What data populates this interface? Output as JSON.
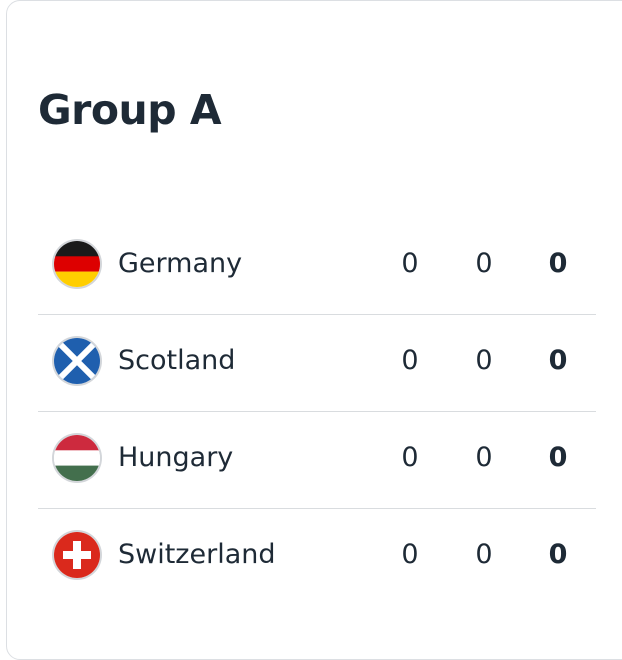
{
  "group": {
    "title": "Group A"
  },
  "teams": [
    {
      "name": "Germany",
      "flag": "germany-flag-icon",
      "col1": "0",
      "col2": "0",
      "col3": "0"
    },
    {
      "name": "Scotland",
      "flag": "scotland-flag-icon",
      "col1": "0",
      "col2": "0",
      "col3": "0"
    },
    {
      "name": "Hungary",
      "flag": "hungary-flag-icon",
      "col1": "0",
      "col2": "0",
      "col3": "0"
    },
    {
      "name": "Switzerland",
      "flag": "switzerland-flag-icon",
      "col1": "0",
      "col2": "0",
      "col3": "0"
    }
  ],
  "colors": {
    "text": "#1e2a36",
    "divider": "#d9dcdf",
    "germany": [
      "#1a1a1a",
      "#dd0000",
      "#ffce00"
    ],
    "scotland": [
      "#1f5fae",
      "#ffffff"
    ],
    "hungary": [
      "#cd2a3e",
      "#ffffff",
      "#436f4d"
    ],
    "switzerland": [
      "#da291c",
      "#ffffff"
    ]
  }
}
